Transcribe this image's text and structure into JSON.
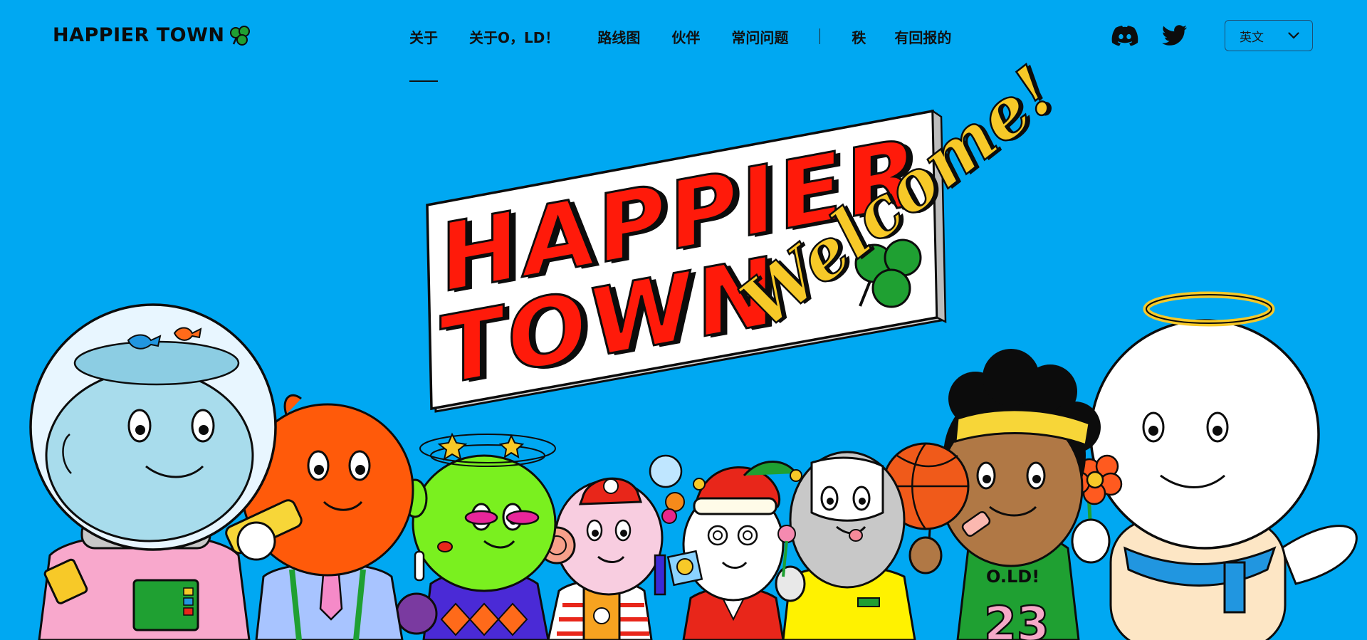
{
  "header": {
    "logo_text": "HAPPIER TOWN",
    "nav": [
      {
        "label": "关于"
      },
      {
        "label": "关于O，LD！"
      },
      {
        "label": "路线图"
      },
      {
        "label": "伙伴"
      },
      {
        "label": "常问问题"
      },
      {
        "label": "秩"
      },
      {
        "label": "有回报的"
      }
    ],
    "active_nav": "关于",
    "social_icons": [
      "discord-icon",
      "twitter-icon"
    ],
    "language": {
      "selected": "英文"
    }
  },
  "hero": {
    "sign": {
      "line1": "HAPPIER",
      "line2": "TOWN",
      "script": "Welcome!"
    },
    "jersey_text": "O.LD!",
    "jersey_number": "23"
  },
  "colors": {
    "background": "#00a8f2",
    "sign_red": "#ff1a0a",
    "sign_yellow": "#f7c928",
    "clover_green": "#1fa032",
    "text": "#0c0c0c"
  }
}
